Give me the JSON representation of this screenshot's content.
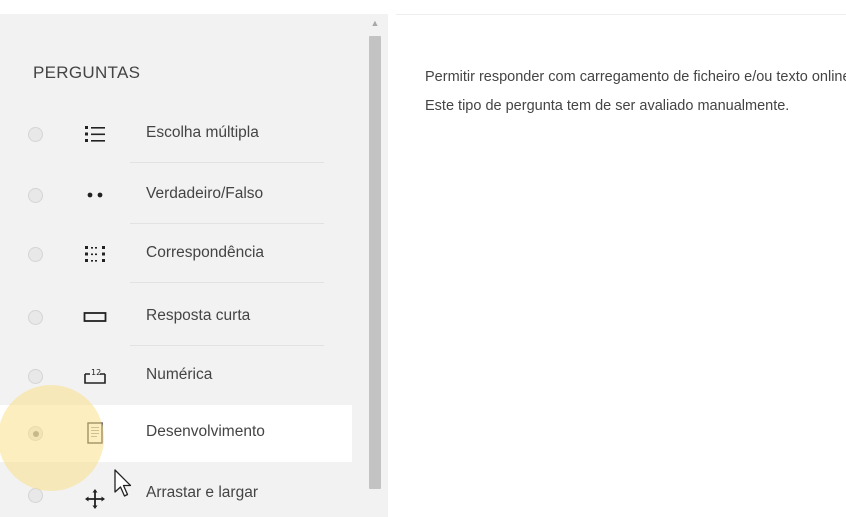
{
  "question_types": {
    "title": "PERGUNTAS",
    "items": [
      {
        "label": "Escolha múltipla",
        "icon": "list-icon",
        "selected": false
      },
      {
        "label": "Verdadeiro/Falso",
        "icon": "two-dots-icon",
        "selected": false
      },
      {
        "label": "Correspondência",
        "icon": "matching-grid-icon",
        "selected": false
      },
      {
        "label": "Resposta curta",
        "icon": "short-answer-box-icon",
        "selected": false
      },
      {
        "label": "Numérica",
        "icon": "numeric-icon",
        "selected": false
      },
      {
        "label": "Desenvolvimento",
        "icon": "essay-document-icon",
        "selected": true
      },
      {
        "label": "Arrastar e largar",
        "icon": "drag-drop-icon",
        "selected": false
      }
    ]
  },
  "description": {
    "text": "Permitir responder com carregamento de ficheiro e/ou texto online. Este tipo de pergunta tem de ser avaliado manualmente."
  },
  "colors": {
    "panel_bg": "#f2f2f2",
    "selected_bg": "#ffffff",
    "highlight": "#fce08c"
  }
}
